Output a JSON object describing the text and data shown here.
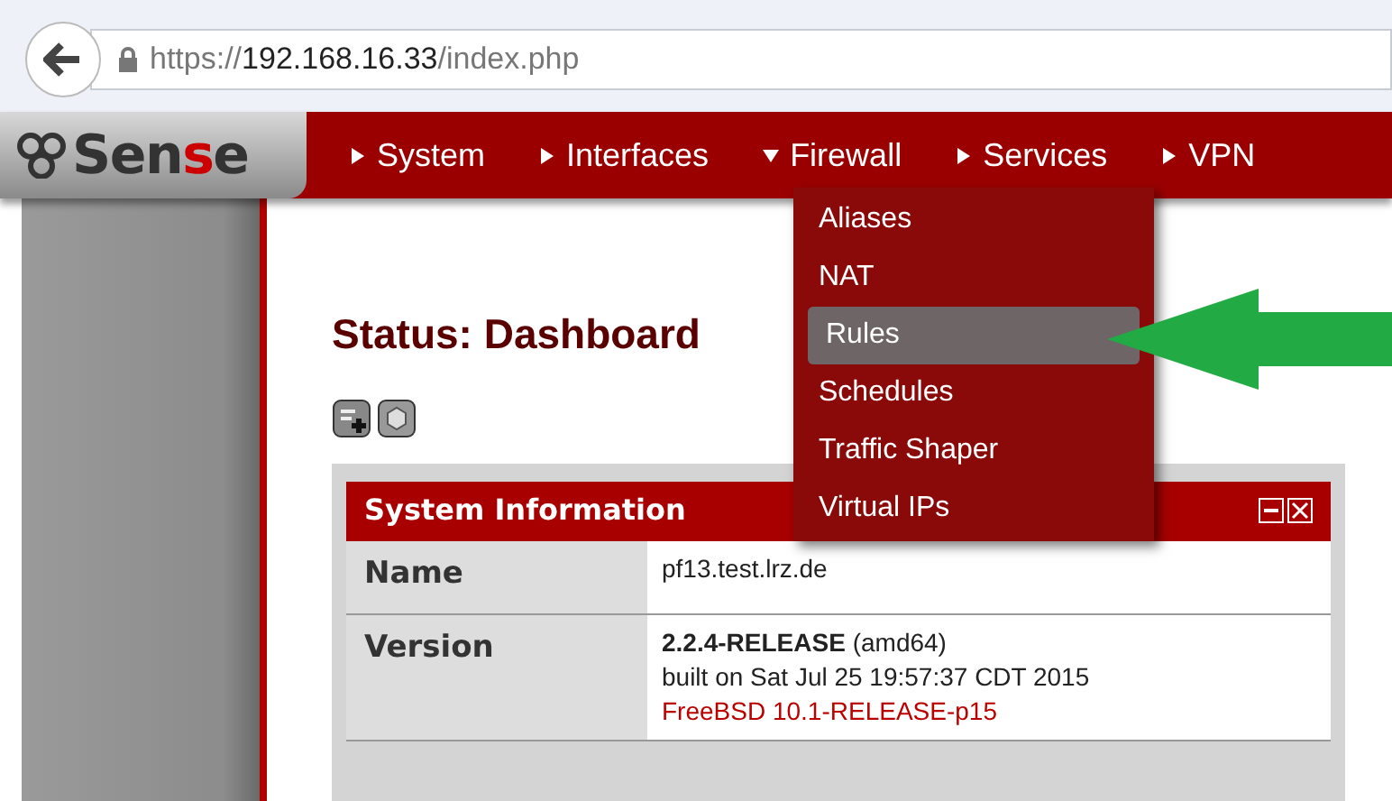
{
  "browser": {
    "url": [
      {
        "text": "https://",
        "kind": "scheme"
      },
      {
        "text": "192.168.16.33",
        "kind": "host"
      },
      {
        "text": "/index.php",
        "kind": "path"
      }
    ]
  },
  "logo": {
    "parts": [
      {
        "text": "Sen",
        "accent": false
      },
      {
        "text": "s",
        "accent": true
      },
      {
        "text": "e",
        "accent": false
      }
    ]
  },
  "nav": [
    {
      "label": "System",
      "expanded": false
    },
    {
      "label": "Interfaces",
      "expanded": false
    },
    {
      "label": "Firewall",
      "expanded": true
    },
    {
      "label": "Services",
      "expanded": false
    },
    {
      "label": "VPN",
      "expanded": false
    }
  ],
  "menu": [
    {
      "label": "Aliases",
      "selected": false
    },
    {
      "label": "NAT",
      "selected": false
    },
    {
      "label": "Rules",
      "selected": true
    },
    {
      "label": "Schedules",
      "selected": false
    },
    {
      "label": "Traffic Shaper",
      "selected": false
    },
    {
      "label": "Virtual IPs",
      "selected": false
    }
  ],
  "page_title": "Status: Dashboard",
  "panel": {
    "title": "System Information",
    "rows": [
      {
        "label": "Name",
        "lines": [
          {
            "text": "pf13.test.lrz.de",
            "kind": "plain"
          }
        ]
      },
      {
        "label": "Version",
        "lines": [
          {
            "text": "**2.2.4-RELEASE** (amd64)",
            "kind": "plain"
          },
          {
            "text": "built on Sat Jul 25 19:57:37 CDT 2015",
            "kind": "plain"
          },
          {
            "text": "FreeBSD 10.1-RELEASE-p15",
            "kind": "highlight"
          }
        ]
      }
    ]
  }
}
